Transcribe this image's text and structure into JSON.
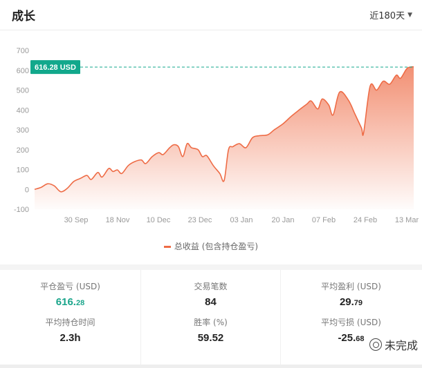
{
  "header": {
    "title": "成长",
    "range_label": "近180天"
  },
  "current_value_tag": "616.28 USD",
  "legend_label": "总收益 (包含持仓盈亏)",
  "colors": {
    "accent": "#ee6b45",
    "tag": "#12a88c",
    "positive": "#1aa58b"
  },
  "stats": {
    "closed_pl": {
      "label": "平仓盈亏 (USD)",
      "int": "616.",
      "dec": "28"
    },
    "trade_count": {
      "label": "交易笔数",
      "value": "84"
    },
    "avg_profit": {
      "label": "平均盈利 (USD)",
      "int": "29.",
      "dec": "79"
    },
    "avg_hold_time": {
      "label": "平均持仓时间",
      "value": "2.3h"
    },
    "win_rate": {
      "label": "胜率 (%)",
      "value": "59.52"
    },
    "avg_loss": {
      "label": "平均亏损 (USD)",
      "int": "-25.",
      "dec": "68"
    }
  },
  "watermark": "未完成",
  "chart_data": {
    "type": "area",
    "title": "",
    "xlabel": "",
    "ylabel": "",
    "ylim": [
      -100,
      700
    ],
    "yticks": [
      -100,
      0,
      100,
      200,
      300,
      400,
      500,
      600,
      700
    ],
    "xticks": [
      "30 Sep",
      "18 Nov",
      "10 Dec",
      "23 Dec",
      "03 Jan",
      "20 Jan",
      "07 Feb",
      "24 Feb",
      "13 Mar"
    ],
    "reference_line": 616.28,
    "grid": false,
    "legend": "bottom",
    "series": [
      {
        "name": "总收益 (包含持仓盈亏)",
        "points": [
          [
            0.0,
            0
          ],
          [
            0.3,
            10
          ],
          [
            0.6,
            28
          ],
          [
            0.9,
            18
          ],
          [
            1.2,
            -12
          ],
          [
            1.5,
            5
          ],
          [
            1.8,
            40
          ],
          [
            2.1,
            55
          ],
          [
            2.4,
            70
          ],
          [
            2.6,
            50
          ],
          [
            2.9,
            85
          ],
          [
            3.1,
            62
          ],
          [
            3.4,
            105
          ],
          [
            3.6,
            90
          ],
          [
            3.8,
            98
          ],
          [
            4.0,
            80
          ],
          [
            4.3,
            120
          ],
          [
            4.6,
            140
          ],
          [
            4.9,
            148
          ],
          [
            5.1,
            130
          ],
          [
            5.4,
            165
          ],
          [
            5.7,
            185
          ],
          [
            5.9,
            175
          ],
          [
            6.2,
            210
          ],
          [
            6.4,
            225
          ],
          [
            6.6,
            215
          ],
          [
            6.8,
            165
          ],
          [
            7.0,
            230
          ],
          [
            7.2,
            210
          ],
          [
            7.5,
            200
          ],
          [
            7.7,
            165
          ],
          [
            7.9,
            170
          ],
          [
            8.2,
            120
          ],
          [
            8.5,
            80
          ],
          [
            8.7,
            45
          ],
          [
            8.9,
            200
          ],
          [
            9.1,
            215
          ],
          [
            9.4,
            230
          ],
          [
            9.7,
            210
          ],
          [
            10.0,
            260
          ],
          [
            10.3,
            270
          ],
          [
            10.7,
            275
          ],
          [
            11.0,
            300
          ],
          [
            11.4,
            330
          ],
          [
            11.8,
            370
          ],
          [
            12.2,
            405
          ],
          [
            12.5,
            430
          ],
          [
            12.7,
            445
          ],
          [
            13.0,
            405
          ],
          [
            13.2,
            455
          ],
          [
            13.5,
            425
          ],
          [
            13.7,
            375
          ],
          [
            14.0,
            490
          ],
          [
            14.4,
            450
          ],
          [
            14.7,
            380
          ],
          [
            15.0,
            310
          ],
          [
            15.1,
            285
          ],
          [
            15.4,
            520
          ],
          [
            15.7,
            500
          ],
          [
            16.0,
            545
          ],
          [
            16.3,
            530
          ],
          [
            16.6,
            575
          ],
          [
            16.8,
            560
          ],
          [
            17.1,
            610
          ],
          [
            17.4,
            618
          ]
        ]
      }
    ]
  }
}
